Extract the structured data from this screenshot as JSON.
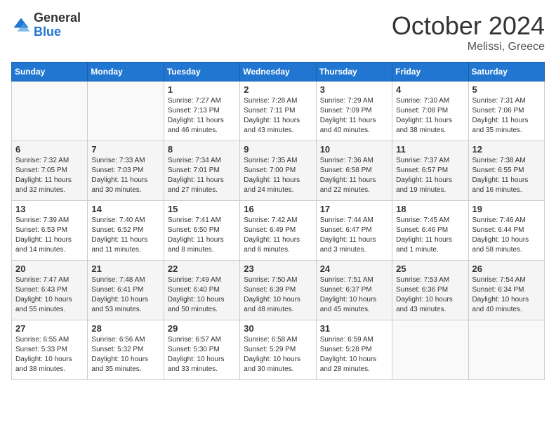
{
  "logo": {
    "general": "General",
    "blue": "Blue"
  },
  "header": {
    "month": "October 2024",
    "location": "Melissi, Greece"
  },
  "weekdays": [
    "Sunday",
    "Monday",
    "Tuesday",
    "Wednesday",
    "Thursday",
    "Friday",
    "Saturday"
  ],
  "weeks": [
    [
      {
        "day": "",
        "sunrise": "",
        "sunset": "",
        "daylight": ""
      },
      {
        "day": "",
        "sunrise": "",
        "sunset": "",
        "daylight": ""
      },
      {
        "day": "1",
        "sunrise": "Sunrise: 7:27 AM",
        "sunset": "Sunset: 7:13 PM",
        "daylight": "Daylight: 11 hours and 46 minutes."
      },
      {
        "day": "2",
        "sunrise": "Sunrise: 7:28 AM",
        "sunset": "Sunset: 7:11 PM",
        "daylight": "Daylight: 11 hours and 43 minutes."
      },
      {
        "day": "3",
        "sunrise": "Sunrise: 7:29 AM",
        "sunset": "Sunset: 7:09 PM",
        "daylight": "Daylight: 11 hours and 40 minutes."
      },
      {
        "day": "4",
        "sunrise": "Sunrise: 7:30 AM",
        "sunset": "Sunset: 7:08 PM",
        "daylight": "Daylight: 11 hours and 38 minutes."
      },
      {
        "day": "5",
        "sunrise": "Sunrise: 7:31 AM",
        "sunset": "Sunset: 7:06 PM",
        "daylight": "Daylight: 11 hours and 35 minutes."
      }
    ],
    [
      {
        "day": "6",
        "sunrise": "Sunrise: 7:32 AM",
        "sunset": "Sunset: 7:05 PM",
        "daylight": "Daylight: 11 hours and 32 minutes."
      },
      {
        "day": "7",
        "sunrise": "Sunrise: 7:33 AM",
        "sunset": "Sunset: 7:03 PM",
        "daylight": "Daylight: 11 hours and 30 minutes."
      },
      {
        "day": "8",
        "sunrise": "Sunrise: 7:34 AM",
        "sunset": "Sunset: 7:01 PM",
        "daylight": "Daylight: 11 hours and 27 minutes."
      },
      {
        "day": "9",
        "sunrise": "Sunrise: 7:35 AM",
        "sunset": "Sunset: 7:00 PM",
        "daylight": "Daylight: 11 hours and 24 minutes."
      },
      {
        "day": "10",
        "sunrise": "Sunrise: 7:36 AM",
        "sunset": "Sunset: 6:58 PM",
        "daylight": "Daylight: 11 hours and 22 minutes."
      },
      {
        "day": "11",
        "sunrise": "Sunrise: 7:37 AM",
        "sunset": "Sunset: 6:57 PM",
        "daylight": "Daylight: 11 hours and 19 minutes."
      },
      {
        "day": "12",
        "sunrise": "Sunrise: 7:38 AM",
        "sunset": "Sunset: 6:55 PM",
        "daylight": "Daylight: 11 hours and 16 minutes."
      }
    ],
    [
      {
        "day": "13",
        "sunrise": "Sunrise: 7:39 AM",
        "sunset": "Sunset: 6:53 PM",
        "daylight": "Daylight: 11 hours and 14 minutes."
      },
      {
        "day": "14",
        "sunrise": "Sunrise: 7:40 AM",
        "sunset": "Sunset: 6:52 PM",
        "daylight": "Daylight: 11 hours and 11 minutes."
      },
      {
        "day": "15",
        "sunrise": "Sunrise: 7:41 AM",
        "sunset": "Sunset: 6:50 PM",
        "daylight": "Daylight: 11 hours and 8 minutes."
      },
      {
        "day": "16",
        "sunrise": "Sunrise: 7:42 AM",
        "sunset": "Sunset: 6:49 PM",
        "daylight": "Daylight: 11 hours and 6 minutes."
      },
      {
        "day": "17",
        "sunrise": "Sunrise: 7:44 AM",
        "sunset": "Sunset: 6:47 PM",
        "daylight": "Daylight: 11 hours and 3 minutes."
      },
      {
        "day": "18",
        "sunrise": "Sunrise: 7:45 AM",
        "sunset": "Sunset: 6:46 PM",
        "daylight": "Daylight: 11 hours and 1 minute."
      },
      {
        "day": "19",
        "sunrise": "Sunrise: 7:46 AM",
        "sunset": "Sunset: 6:44 PM",
        "daylight": "Daylight: 10 hours and 58 minutes."
      }
    ],
    [
      {
        "day": "20",
        "sunrise": "Sunrise: 7:47 AM",
        "sunset": "Sunset: 6:43 PM",
        "daylight": "Daylight: 10 hours and 55 minutes."
      },
      {
        "day": "21",
        "sunrise": "Sunrise: 7:48 AM",
        "sunset": "Sunset: 6:41 PM",
        "daylight": "Daylight: 10 hours and 53 minutes."
      },
      {
        "day": "22",
        "sunrise": "Sunrise: 7:49 AM",
        "sunset": "Sunset: 6:40 PM",
        "daylight": "Daylight: 10 hours and 50 minutes."
      },
      {
        "day": "23",
        "sunrise": "Sunrise: 7:50 AM",
        "sunset": "Sunset: 6:39 PM",
        "daylight": "Daylight: 10 hours and 48 minutes."
      },
      {
        "day": "24",
        "sunrise": "Sunrise: 7:51 AM",
        "sunset": "Sunset: 6:37 PM",
        "daylight": "Daylight: 10 hours and 45 minutes."
      },
      {
        "day": "25",
        "sunrise": "Sunrise: 7:53 AM",
        "sunset": "Sunset: 6:36 PM",
        "daylight": "Daylight: 10 hours and 43 minutes."
      },
      {
        "day": "26",
        "sunrise": "Sunrise: 7:54 AM",
        "sunset": "Sunset: 6:34 PM",
        "daylight": "Daylight: 10 hours and 40 minutes."
      }
    ],
    [
      {
        "day": "27",
        "sunrise": "Sunrise: 6:55 AM",
        "sunset": "Sunset: 5:33 PM",
        "daylight": "Daylight: 10 hours and 38 minutes."
      },
      {
        "day": "28",
        "sunrise": "Sunrise: 6:56 AM",
        "sunset": "Sunset: 5:32 PM",
        "daylight": "Daylight: 10 hours and 35 minutes."
      },
      {
        "day": "29",
        "sunrise": "Sunrise: 6:57 AM",
        "sunset": "Sunset: 5:30 PM",
        "daylight": "Daylight: 10 hours and 33 minutes."
      },
      {
        "day": "30",
        "sunrise": "Sunrise: 6:58 AM",
        "sunset": "Sunset: 5:29 PM",
        "daylight": "Daylight: 10 hours and 30 minutes."
      },
      {
        "day": "31",
        "sunrise": "Sunrise: 6:59 AM",
        "sunset": "Sunset: 5:28 PM",
        "daylight": "Daylight: 10 hours and 28 minutes."
      },
      {
        "day": "",
        "sunrise": "",
        "sunset": "",
        "daylight": ""
      },
      {
        "day": "",
        "sunrise": "",
        "sunset": "",
        "daylight": ""
      }
    ]
  ]
}
